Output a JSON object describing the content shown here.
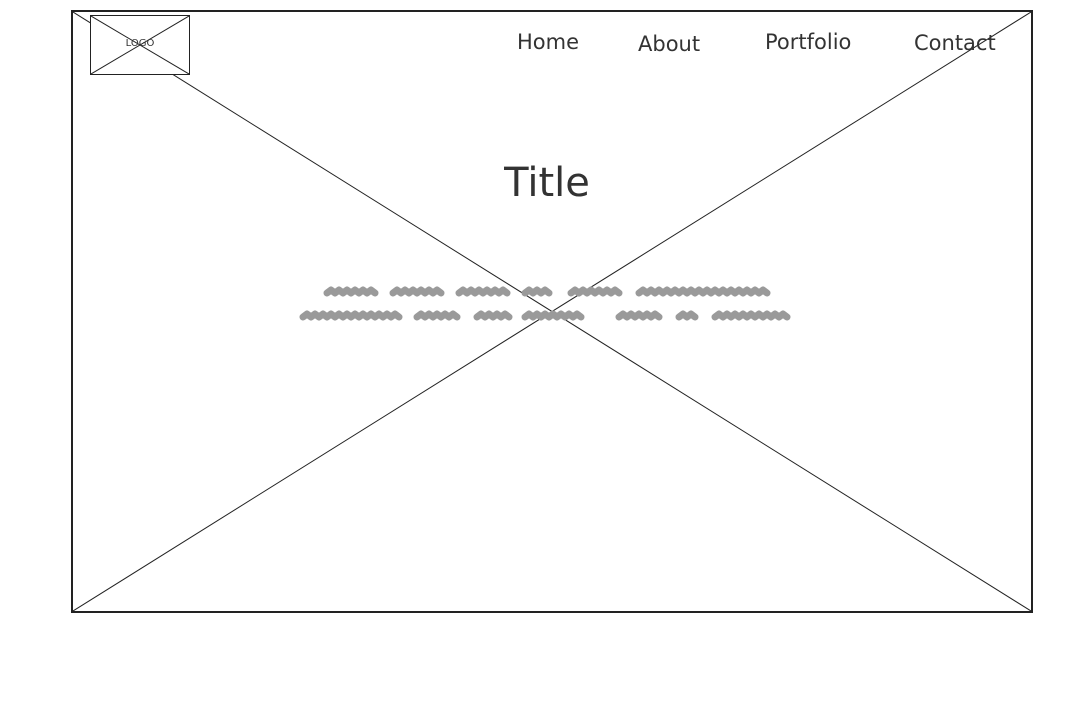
{
  "header": {
    "logo_label": "LOGO",
    "nav": [
      {
        "label": "Home"
      },
      {
        "label": "About"
      },
      {
        "label": "Portfolio"
      },
      {
        "label": "Contact"
      }
    ]
  },
  "hero": {
    "title": "Title"
  },
  "colors": {
    "stroke": "#222222",
    "text": "#333333",
    "scribble": "#9a9a9a",
    "background": "#ffffff"
  }
}
